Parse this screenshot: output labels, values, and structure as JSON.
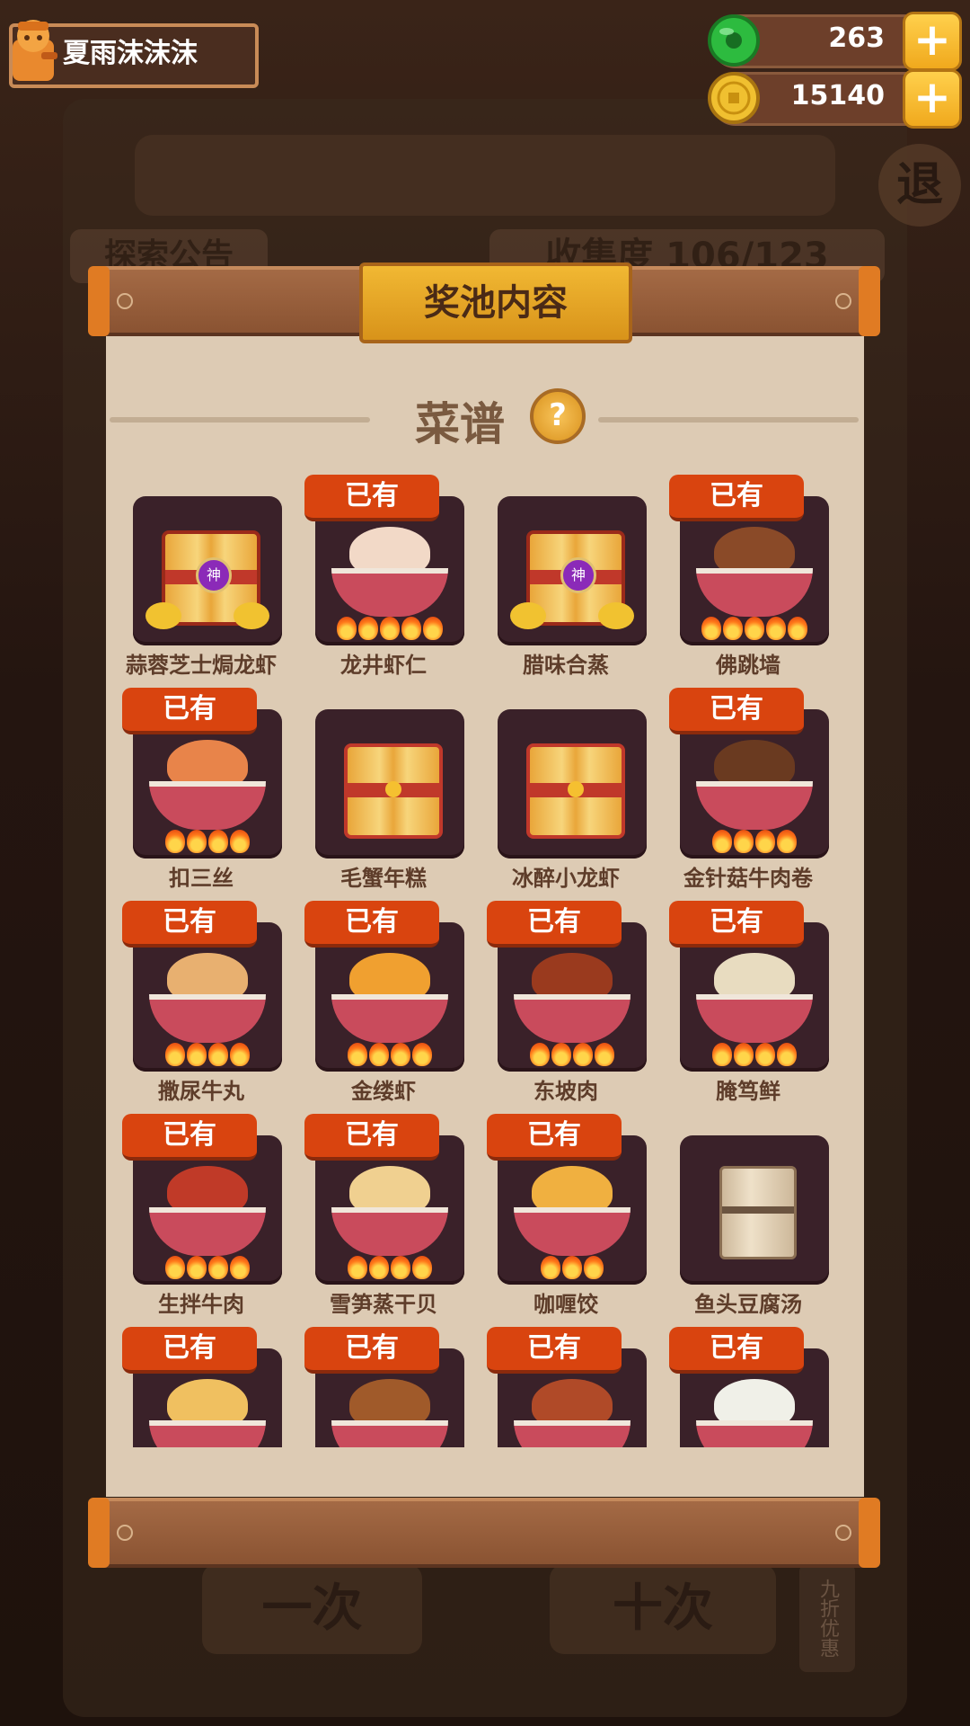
{
  "player": {
    "name": "夏雨沫沫沫"
  },
  "resources": [
    {
      "id": "jade",
      "value": "263",
      "color": "#2dbb3f"
    },
    {
      "id": "coin",
      "value": "15140",
      "color": "#f0c030"
    }
  ],
  "background": {
    "left_tag": "探索公告",
    "right_tag": "收集度 106/123",
    "exit_label": "退",
    "btn_single": "一次",
    "btn_ten": "十次",
    "side_label": "九折优惠"
  },
  "panel": {
    "title": "奖池内容",
    "section_title": "菜谱",
    "help_icon": "?",
    "owned_label": "已有"
  },
  "dishes": [
    {
      "name": "蒜蓉芝士焗龙虾",
      "owned": false,
      "icon": "god-chest-icon",
      "flames": 0
    },
    {
      "name": "龙井虾仁",
      "owned": true,
      "icon": "shrimp-dish-icon",
      "flames": 5,
      "color": "#f2d9c7"
    },
    {
      "name": "腊味合蒸",
      "owned": false,
      "icon": "god-chest-icon",
      "flames": 0
    },
    {
      "name": "佛跳墙",
      "owned": true,
      "icon": "stew-pot-icon",
      "flames": 5,
      "color": "#8a4a28"
    },
    {
      "name": "扣三丝",
      "owned": true,
      "icon": "shredded-dish-icon",
      "flames": 4,
      "color": "#e8844a"
    },
    {
      "name": "毛蟹年糕",
      "owned": false,
      "icon": "gift-chest-icon",
      "flames": 0
    },
    {
      "name": "冰醉小龙虾",
      "owned": false,
      "icon": "gift-chest-icon",
      "flames": 0
    },
    {
      "name": "金针菇牛肉卷",
      "owned": true,
      "icon": "beef-roll-icon",
      "flames": 4,
      "color": "#6a3a20"
    },
    {
      "name": "撒尿牛丸",
      "owned": true,
      "icon": "meatball-dish-icon",
      "flames": 4,
      "color": "#e8b070"
    },
    {
      "name": "金缕虾",
      "owned": true,
      "icon": "golden-shrimp-icon",
      "flames": 4,
      "color": "#f0a030"
    },
    {
      "name": "东坡肉",
      "owned": true,
      "icon": "braised-pork-icon",
      "flames": 4,
      "color": "#9a3a1e"
    },
    {
      "name": "腌笃鲜",
      "owned": true,
      "icon": "soup-pot-icon",
      "flames": 4,
      "color": "#e8dcc0"
    },
    {
      "name": "生拌牛肉",
      "owned": true,
      "icon": "raw-beef-icon",
      "flames": 4,
      "color": "#c03a28"
    },
    {
      "name": "雪笋蒸干贝",
      "owned": true,
      "icon": "scallop-dish-icon",
      "flames": 4,
      "color": "#f0d090"
    },
    {
      "name": "咖喱饺",
      "owned": true,
      "icon": "curry-dumpling-icon",
      "flames": 3,
      "color": "#f0b040"
    },
    {
      "name": "鱼头豆腐汤",
      "owned": false,
      "icon": "recipe-scroll-icon",
      "flames": 0
    },
    {
      "name": "",
      "owned": true,
      "icon": "fried-rice-icon",
      "flames": 0,
      "color": "#f0c060"
    },
    {
      "name": "",
      "owned": true,
      "icon": "skewer-dish-icon",
      "flames": 0,
      "color": "#a05a2a"
    },
    {
      "name": "",
      "owned": true,
      "icon": "meat-dish-icon",
      "flames": 0,
      "color": "#b04a28"
    },
    {
      "name": "",
      "owned": true,
      "icon": "rice-bowl-icon",
      "flames": 0,
      "color": "#f0f0e8"
    }
  ]
}
